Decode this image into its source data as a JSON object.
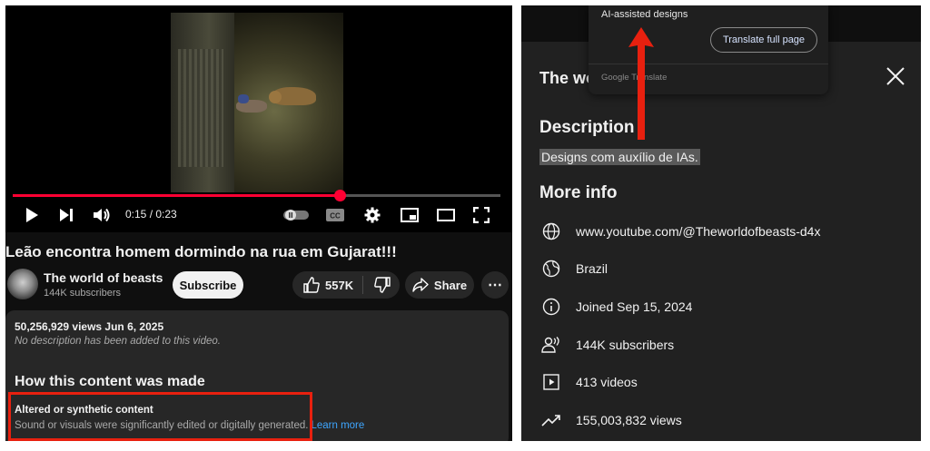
{
  "left": {
    "player": {
      "time": "0:15 / 0:23",
      "progress_fraction": 0.67,
      "cc_label": "CC"
    },
    "video": {
      "title": "Leão encontra homem dormindo na rua em Gujarat!!!",
      "channel_name": "The world of beasts",
      "subscribers": "144K subscribers",
      "subscribe_label": "Subscribe",
      "likes": "557K",
      "share_label": "Share",
      "more_label": "⋯"
    },
    "description": {
      "views_date": "50,256,929 views  Jun 6, 2025",
      "no_description": "No description has been added to this video.",
      "how_made_heading": "How this content was made",
      "altered_title": "Altered or synthetic content",
      "altered_desc": "Sound or visuals were significantly edited or digitally generated.",
      "learn_more": "Learn more"
    }
  },
  "right": {
    "translate_popup": {
      "text": "AI-assisted designs",
      "button": "Translate full page",
      "brand": "Google Translate"
    },
    "sheet": {
      "title": "The wo",
      "description_heading": "Description",
      "description_text": "Designs com auxílio de IAs.",
      "more_info_heading": "More info",
      "info": [
        {
          "icon": "globe-icon",
          "text": "www.youtube.com/@Theworldofbeasts-d4x"
        },
        {
          "icon": "earth-icon",
          "text": "Brazil"
        },
        {
          "icon": "info-icon",
          "text": "Joined Sep 15, 2024"
        },
        {
          "icon": "people-icon",
          "text": "144K subscribers"
        },
        {
          "icon": "video-icon",
          "text": "413 videos"
        },
        {
          "icon": "trending-icon",
          "text": "155,003,832 views"
        }
      ]
    }
  },
  "colors": {
    "accent_red": "#ff0033",
    "annotation_red": "#e8200f",
    "link_blue": "#3ea6ff"
  }
}
